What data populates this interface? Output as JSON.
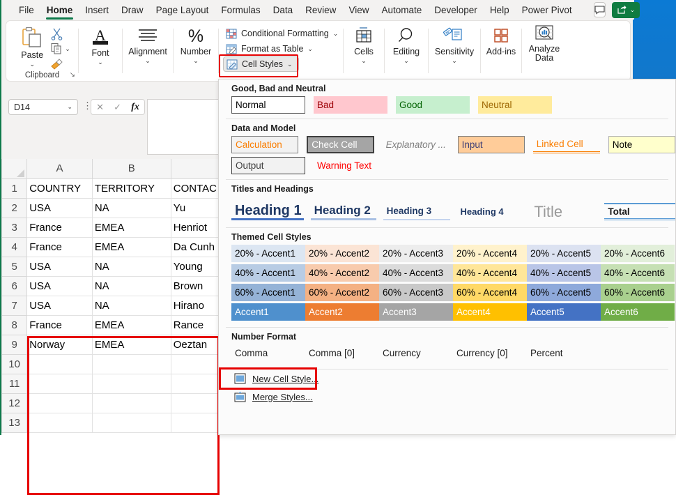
{
  "window": {
    "app": "Excel"
  },
  "menubar": {
    "items": [
      {
        "label": "File",
        "active": false
      },
      {
        "label": "Home",
        "active": true
      },
      {
        "label": "Insert",
        "active": false
      },
      {
        "label": "Draw",
        "active": false
      },
      {
        "label": "Page Layout",
        "active": false
      },
      {
        "label": "Formulas",
        "active": false
      },
      {
        "label": "Data",
        "active": false
      },
      {
        "label": "Review",
        "active": false
      },
      {
        "label": "View",
        "active": false
      },
      {
        "label": "Automate",
        "active": false
      },
      {
        "label": "Developer",
        "active": false
      },
      {
        "label": "Help",
        "active": false
      },
      {
        "label": "Power Pivot",
        "active": false
      }
    ],
    "comment_icon": "comment-icon",
    "share_icon": "share-icon",
    "share_caret": "⌄"
  },
  "ribbon": {
    "clipboard": {
      "paste_label": "Paste",
      "paste_caret": "⌄",
      "group_name": "Clipboard",
      "dialog_launcher": "↘",
      "cut_icon": "scissors-icon",
      "copy_icon": "copy-icon",
      "copy_caret": "⌄",
      "format_painter_icon": "format-painter-icon"
    },
    "font": {
      "label": "Font",
      "caret": "⌄",
      "icon": "font-a-icon"
    },
    "alignment": {
      "label": "Alignment",
      "caret": "⌄",
      "icon": "alignment-lines-icon"
    },
    "number": {
      "label": "Number",
      "caret": "⌄",
      "icon": "percent-icon"
    },
    "styles": {
      "conditional_formatting": "Conditional Formatting",
      "conditional_formatting_caret": "⌄",
      "format_as_table": "Format as Table",
      "format_as_table_caret": "⌄",
      "cell_styles": "Cell Styles",
      "cell_styles_caret": "⌄"
    },
    "cells": {
      "label": "Cells",
      "caret": "⌄",
      "icon": "cells-table-icon"
    },
    "editing": {
      "label": "Editing",
      "caret": "⌄",
      "icon": "magnifier-icon"
    },
    "sensitivity": {
      "label": "Sensitivity",
      "caret": "⌄",
      "icon": "sensitivity-label-icon"
    },
    "addins": {
      "label": "Add-ins",
      "icon": "addins-grid-icon"
    },
    "analyze": {
      "label1": "Analyze",
      "label2": "Data",
      "icon": "analyze-data-icon"
    }
  },
  "formula_bar": {
    "name_box_value": "D14",
    "name_box_caret": "⌄",
    "more_dots": "⋮",
    "cancel": "✕",
    "enter": "✓",
    "fx": "fx",
    "formula_value": ""
  },
  "grid": {
    "columns": [
      "A",
      "B",
      ""
    ],
    "rows": [
      {
        "num": "1",
        "cells": [
          "COUNTRY",
          "TERRITORY",
          "CONTAC"
        ],
        "header": true
      },
      {
        "num": "2",
        "cells": [
          "USA",
          "NA",
          "Yu"
        ],
        "header": false
      },
      {
        "num": "3",
        "cells": [
          "France",
          "EMEA",
          "Henriot"
        ],
        "header": false
      },
      {
        "num": "4",
        "cells": [
          "France",
          "EMEA",
          "Da Cunh"
        ],
        "header": false
      },
      {
        "num": "5",
        "cells": [
          "USA",
          "NA",
          "Young"
        ],
        "header": false
      },
      {
        "num": "6",
        "cells": [
          "USA",
          "NA",
          "Brown"
        ],
        "header": false
      },
      {
        "num": "7",
        "cells": [
          "USA",
          "NA",
          "Hirano"
        ],
        "header": false
      },
      {
        "num": "8",
        "cells": [
          "France",
          "EMEA",
          "Rance"
        ],
        "header": false
      },
      {
        "num": "9",
        "cells": [
          "Norway",
          "EMEA",
          "Oeztan"
        ],
        "header": false
      },
      {
        "num": "10",
        "cells": [
          "",
          "",
          ""
        ],
        "header": false
      },
      {
        "num": "11",
        "cells": [
          "",
          "",
          ""
        ],
        "header": false
      },
      {
        "num": "12",
        "cells": [
          "",
          "",
          ""
        ],
        "header": false
      },
      {
        "num": "13",
        "cells": [
          "",
          "",
          ""
        ],
        "header": false
      }
    ]
  },
  "gallery": {
    "sections": {
      "good_bad_neutral": {
        "title": "Good, Bad and Neutral",
        "items": [
          {
            "label": "Normal",
            "bg": "#ffffff",
            "fg": "#000000",
            "border": "#595959"
          },
          {
            "label": "Bad",
            "bg": "#ffc7ce",
            "fg": "#9c0006",
            "border": "#ffc7ce"
          },
          {
            "label": "Good",
            "bg": "#c6efce",
            "fg": "#006100",
            "border": "#c6efce"
          },
          {
            "label": "Neutral",
            "bg": "#ffeb9c",
            "fg": "#9c6500",
            "border": "#ffeb9c"
          }
        ]
      },
      "data_and_model": {
        "title": "Data and Model",
        "row1": [
          {
            "label": "Calculation",
            "bg": "#f2f2f2",
            "fg": "#fa7d00",
            "border": "#7f7f7f"
          },
          {
            "label": "Check Cell",
            "bg": "#a5a5a5",
            "fg": "#ffffff",
            "border": "#3f3f3f"
          },
          {
            "label": "Explanatory ...",
            "bg": "#fbfbfb",
            "fg": "#7f7f7f",
            "border": "none"
          },
          {
            "label": "Input",
            "bg": "#ffcc99",
            "fg": "#3f3f76",
            "border": "#7f7f7f"
          },
          {
            "label": "Linked Cell",
            "bg": "#fbfbfb",
            "fg": "#fa7d00",
            "border": "none"
          },
          {
            "label": "Note",
            "bg": "#ffffcc",
            "fg": "#000000",
            "border": "#b2b2b2"
          }
        ],
        "row2": [
          {
            "label": "Output",
            "bg": "#f2f2f2",
            "fg": "#3f3f3f",
            "border": "#3f3f3f"
          },
          {
            "label": "Warning Text",
            "bg": "#fbfbfb",
            "fg": "#ff0000",
            "border": "none"
          }
        ]
      },
      "titles_and_headings": {
        "title": "Titles and Headings",
        "items": [
          "Heading 1",
          "Heading 2",
          "Heading 3",
          "Heading 4",
          "Title",
          "Total"
        ]
      },
      "themed_cell_styles": {
        "title": "Themed Cell Styles",
        "rows": [
          [
            {
              "label": "20% - Accent1",
              "bg": "#dce6f2",
              "fg": "#000000"
            },
            {
              "label": "20% - Accent2",
              "bg": "#fbe4d5",
              "fg": "#000000"
            },
            {
              "label": "20% - Accent3",
              "bg": "#ededed",
              "fg": "#000000"
            },
            {
              "label": "20% - Accent4",
              "bg": "#fff2cc",
              "fg": "#000000"
            },
            {
              "label": "20% - Accent5",
              "bg": "#dce2f1",
              "fg": "#000000"
            },
            {
              "label": "20% - Accent6",
              "bg": "#e2efda",
              "fg": "#000000"
            }
          ],
          [
            {
              "label": "40% - Accent1",
              "bg": "#b8cce4",
              "fg": "#000000"
            },
            {
              "label": "40% - Accent2",
              "bg": "#f8cbad",
              "fg": "#000000"
            },
            {
              "label": "40% - Accent3",
              "bg": "#dbdbdb",
              "fg": "#000000"
            },
            {
              "label": "40% - Accent4",
              "bg": "#ffe699",
              "fg": "#000000"
            },
            {
              "label": "40% - Accent5",
              "bg": "#b9c5e7",
              "fg": "#000000"
            },
            {
              "label": "40% - Accent6",
              "bg": "#c6e0b4",
              "fg": "#000000"
            }
          ],
          [
            {
              "label": "60% - Accent1",
              "bg": "#95b3d7",
              "fg": "#000000"
            },
            {
              "label": "60% - Accent2",
              "bg": "#f4b183",
              "fg": "#000000"
            },
            {
              "label": "60% - Accent3",
              "bg": "#c9c9c9",
              "fg": "#000000"
            },
            {
              "label": "60% - Accent4",
              "bg": "#ffd966",
              "fg": "#000000"
            },
            {
              "label": "60% - Accent5",
              "bg": "#8ea9db",
              "fg": "#000000"
            },
            {
              "label": "60% - Accent6",
              "bg": "#a9d08e",
              "fg": "#000000"
            }
          ],
          [
            {
              "label": "Accent1",
              "bg": "#4f90cd",
              "fg": "#ffffff"
            },
            {
              "label": "Accent2",
              "bg": "#ed7d31",
              "fg": "#ffffff"
            },
            {
              "label": "Accent3",
              "bg": "#a5a5a5",
              "fg": "#ffffff"
            },
            {
              "label": "Accent4",
              "bg": "#ffc000",
              "fg": "#ffffff"
            },
            {
              "label": "Accent5",
              "bg": "#4472c4",
              "fg": "#ffffff"
            },
            {
              "label": "Accent6",
              "bg": "#70ad47",
              "fg": "#ffffff"
            }
          ]
        ]
      },
      "number_format": {
        "title": "Number Format",
        "items": [
          "Comma",
          "Comma [0]",
          "Currency",
          "Currency [0]",
          "Percent"
        ]
      }
    },
    "footer": {
      "new_cell_style": "New Cell Style...",
      "merge_styles": "Merge Styles...",
      "new_cell_style_icon": "new-cell-style-icon",
      "merge_styles_icon": "merge-styles-icon"
    }
  },
  "annotations": {
    "highlight_color": "#e60000",
    "highlights": [
      "cell-styles-button",
      "data-range-a1-c9",
      "new-cell-style-item"
    ]
  }
}
